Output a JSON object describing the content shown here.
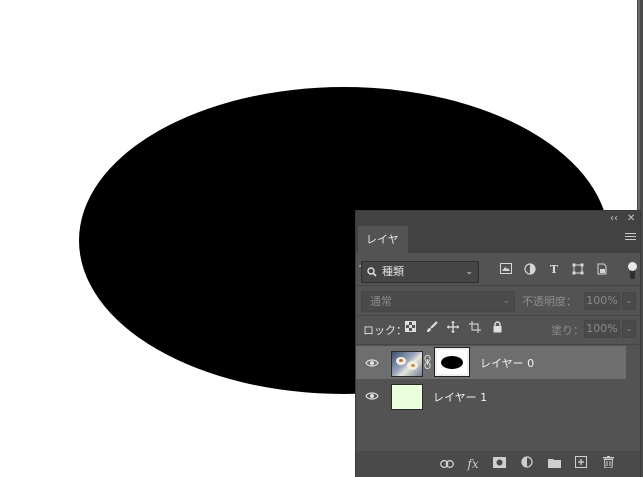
{
  "panel": {
    "title_buttons": {
      "collapse": "‹‹",
      "close": "✕"
    },
    "tab_label": "レイヤー",
    "filter": {
      "label": "種類",
      "chevron": "⌄"
    },
    "blend": {
      "mode": "通常",
      "opacity_label": "不透明度：",
      "opacity_value": "100%"
    },
    "lock": {
      "label": "ロック：",
      "fill_label": "塗り：",
      "fill_value": "100%"
    },
    "layers": [
      {
        "name": "レイヤー 0",
        "selected": true,
        "has_mask": true
      },
      {
        "name": "レイヤー 1",
        "selected": false,
        "thumbnail_color": "#eaffdc"
      }
    ]
  },
  "colors": {
    "panel_bg": "#535353",
    "selected_row": "#6e6e6e",
    "canvas_shape": "#000000"
  }
}
